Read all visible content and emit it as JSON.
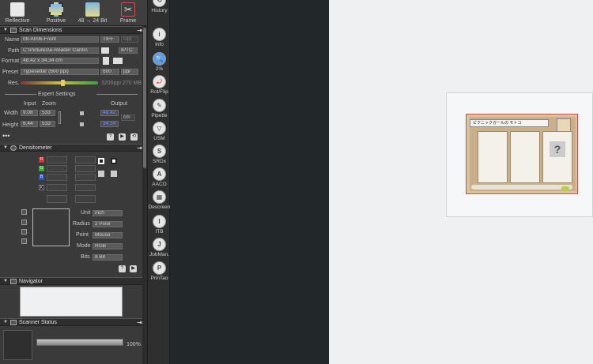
{
  "toolbar": [
    {
      "label": "Reflective",
      "icon": "reflective-icon"
    },
    {
      "label": "Positive",
      "icon": "positive-film-icon"
    },
    {
      "label": "48 → 24 Bit",
      "icon": "bit-depth-icon"
    },
    {
      "label": "Frame",
      "icon": "frame-tools-icon"
    }
  ],
  "scan_dimensions": {
    "title": "Scan Dimensions",
    "name_label": "Name",
    "name_value": "08-A006-Front",
    "name_format": "TIFF",
    "name_extra": "Opt",
    "path_label": "Path",
    "path_value": "C:\\Pictures\\e-Reader Cards\\",
    "path_iptc": "IPTC",
    "format_label": "Format",
    "format_value": "48.42 x 34.34 cm",
    "preset_label": "Preset",
    "preset_value": "Typesetter (600 ppi)",
    "preset_ppi": "600",
    "preset_unit": "ppi",
    "res_label": "Res.",
    "res_value": "3200ppi 270 MB",
    "res_fraction": 0.55
  },
  "expert": {
    "title": "Expert Settings",
    "input_label": "Input",
    "zoom_label": "Zoom",
    "output_label": "Output",
    "width_label": "Width",
    "width_input": "9.08",
    "width_zoom": "533",
    "width_output": "48.42",
    "height_label": "Height",
    "height_input": "6.44",
    "height_zoom": "533",
    "height_output": "34.34",
    "unit": "cm"
  },
  "densitometer": {
    "title": "Densitometer",
    "channels": [
      "R",
      "G",
      "B",
      "K"
    ],
    "unit_label": "Unit",
    "unit_value": "inch",
    "radius_label": "Radius",
    "radius_value": "2 Pixel",
    "point_label": "Point",
    "point_value": "Mouse",
    "mode_label": "Mode",
    "mode_value": "RGB",
    "bits_label": "Bits",
    "bits_value": "8 Bit"
  },
  "navigator": {
    "title": "Navigator"
  },
  "scanner_status": {
    "title": "Scanner Status",
    "progress_text": "100%",
    "progress_fraction": 1.0
  },
  "tools": [
    {
      "label": "History",
      "icon": "history-icon",
      "glyph": "⟲"
    },
    {
      "label": "Info",
      "icon": "info-icon",
      "glyph": "i"
    },
    {
      "label": "2%",
      "icon": "zoom-icon",
      "glyph": "🔍"
    },
    {
      "label": "Rot/Flip",
      "icon": "rotate-flip-icon",
      "glyph": "⤾"
    },
    {
      "label": "Pipette",
      "icon": "pipette-icon",
      "glyph": "✎"
    },
    {
      "label": "USM",
      "icon": "usm-icon",
      "glyph": "▽"
    },
    {
      "label": "SRDx",
      "icon": "srdx-icon",
      "glyph": "S"
    },
    {
      "label": "AACO",
      "icon": "aaco-icon",
      "glyph": "A"
    },
    {
      "label": "Descreen",
      "icon": "descreen-icon",
      "glyph": "▦"
    },
    {
      "label": "ITB",
      "icon": "itb-icon",
      "glyph": "I"
    },
    {
      "label": "JobMan.",
      "icon": "job-manager-icon",
      "glyph": "J"
    },
    {
      "label": "PrinTao",
      "icon": "printao-icon",
      "glyph": "P"
    }
  ],
  "card": {
    "title": "ピクニックガールの モトコ"
  },
  "colors": {
    "accent": "#3b6cff",
    "panel": "#3a3a3a",
    "dark": "#22272a",
    "preview_bg": "#eef0f1",
    "card_border": "#d84a4a"
  }
}
